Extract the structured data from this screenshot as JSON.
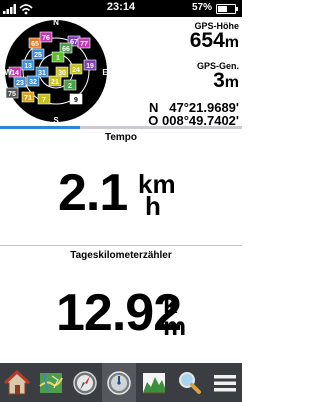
{
  "status_bar": {
    "time": "23:14",
    "battery_percent": "57%",
    "battery_level": 0.57
  },
  "satellites": {
    "labels": [
      "65",
      "76",
      "67",
      "77",
      "66",
      "25",
      "1",
      "13",
      "14",
      "19",
      "31",
      "30",
      "24",
      "23",
      "32",
      "21",
      "2",
      "71",
      "7",
      "9",
      "75"
    ],
    "compass": [
      "N",
      "W",
      "E",
      "S"
    ]
  },
  "gps": {
    "altitude_label": "GPS-Höhe",
    "altitude_value": "654",
    "altitude_unit": "m",
    "accuracy_label": "GPS-Gen.",
    "accuracy_value": "3",
    "accuracy_unit": "m",
    "lat": "N   47°21.9689'",
    "lon": "O 008°49.7402'"
  },
  "fields": {
    "speed": {
      "title": "Tempo",
      "value": "2.1",
      "unit_top": "km",
      "unit_bottom": "h"
    },
    "trip": {
      "title": "Tageskilometerzähler",
      "value": "12.92",
      "unit_top": "k",
      "unit_bottom": "m"
    }
  },
  "navbar": {
    "items": [
      "home-icon",
      "map-icon",
      "compass-icon",
      "trip-computer-icon",
      "elevation-plot-icon",
      "search-icon",
      "menu-icon"
    ]
  }
}
